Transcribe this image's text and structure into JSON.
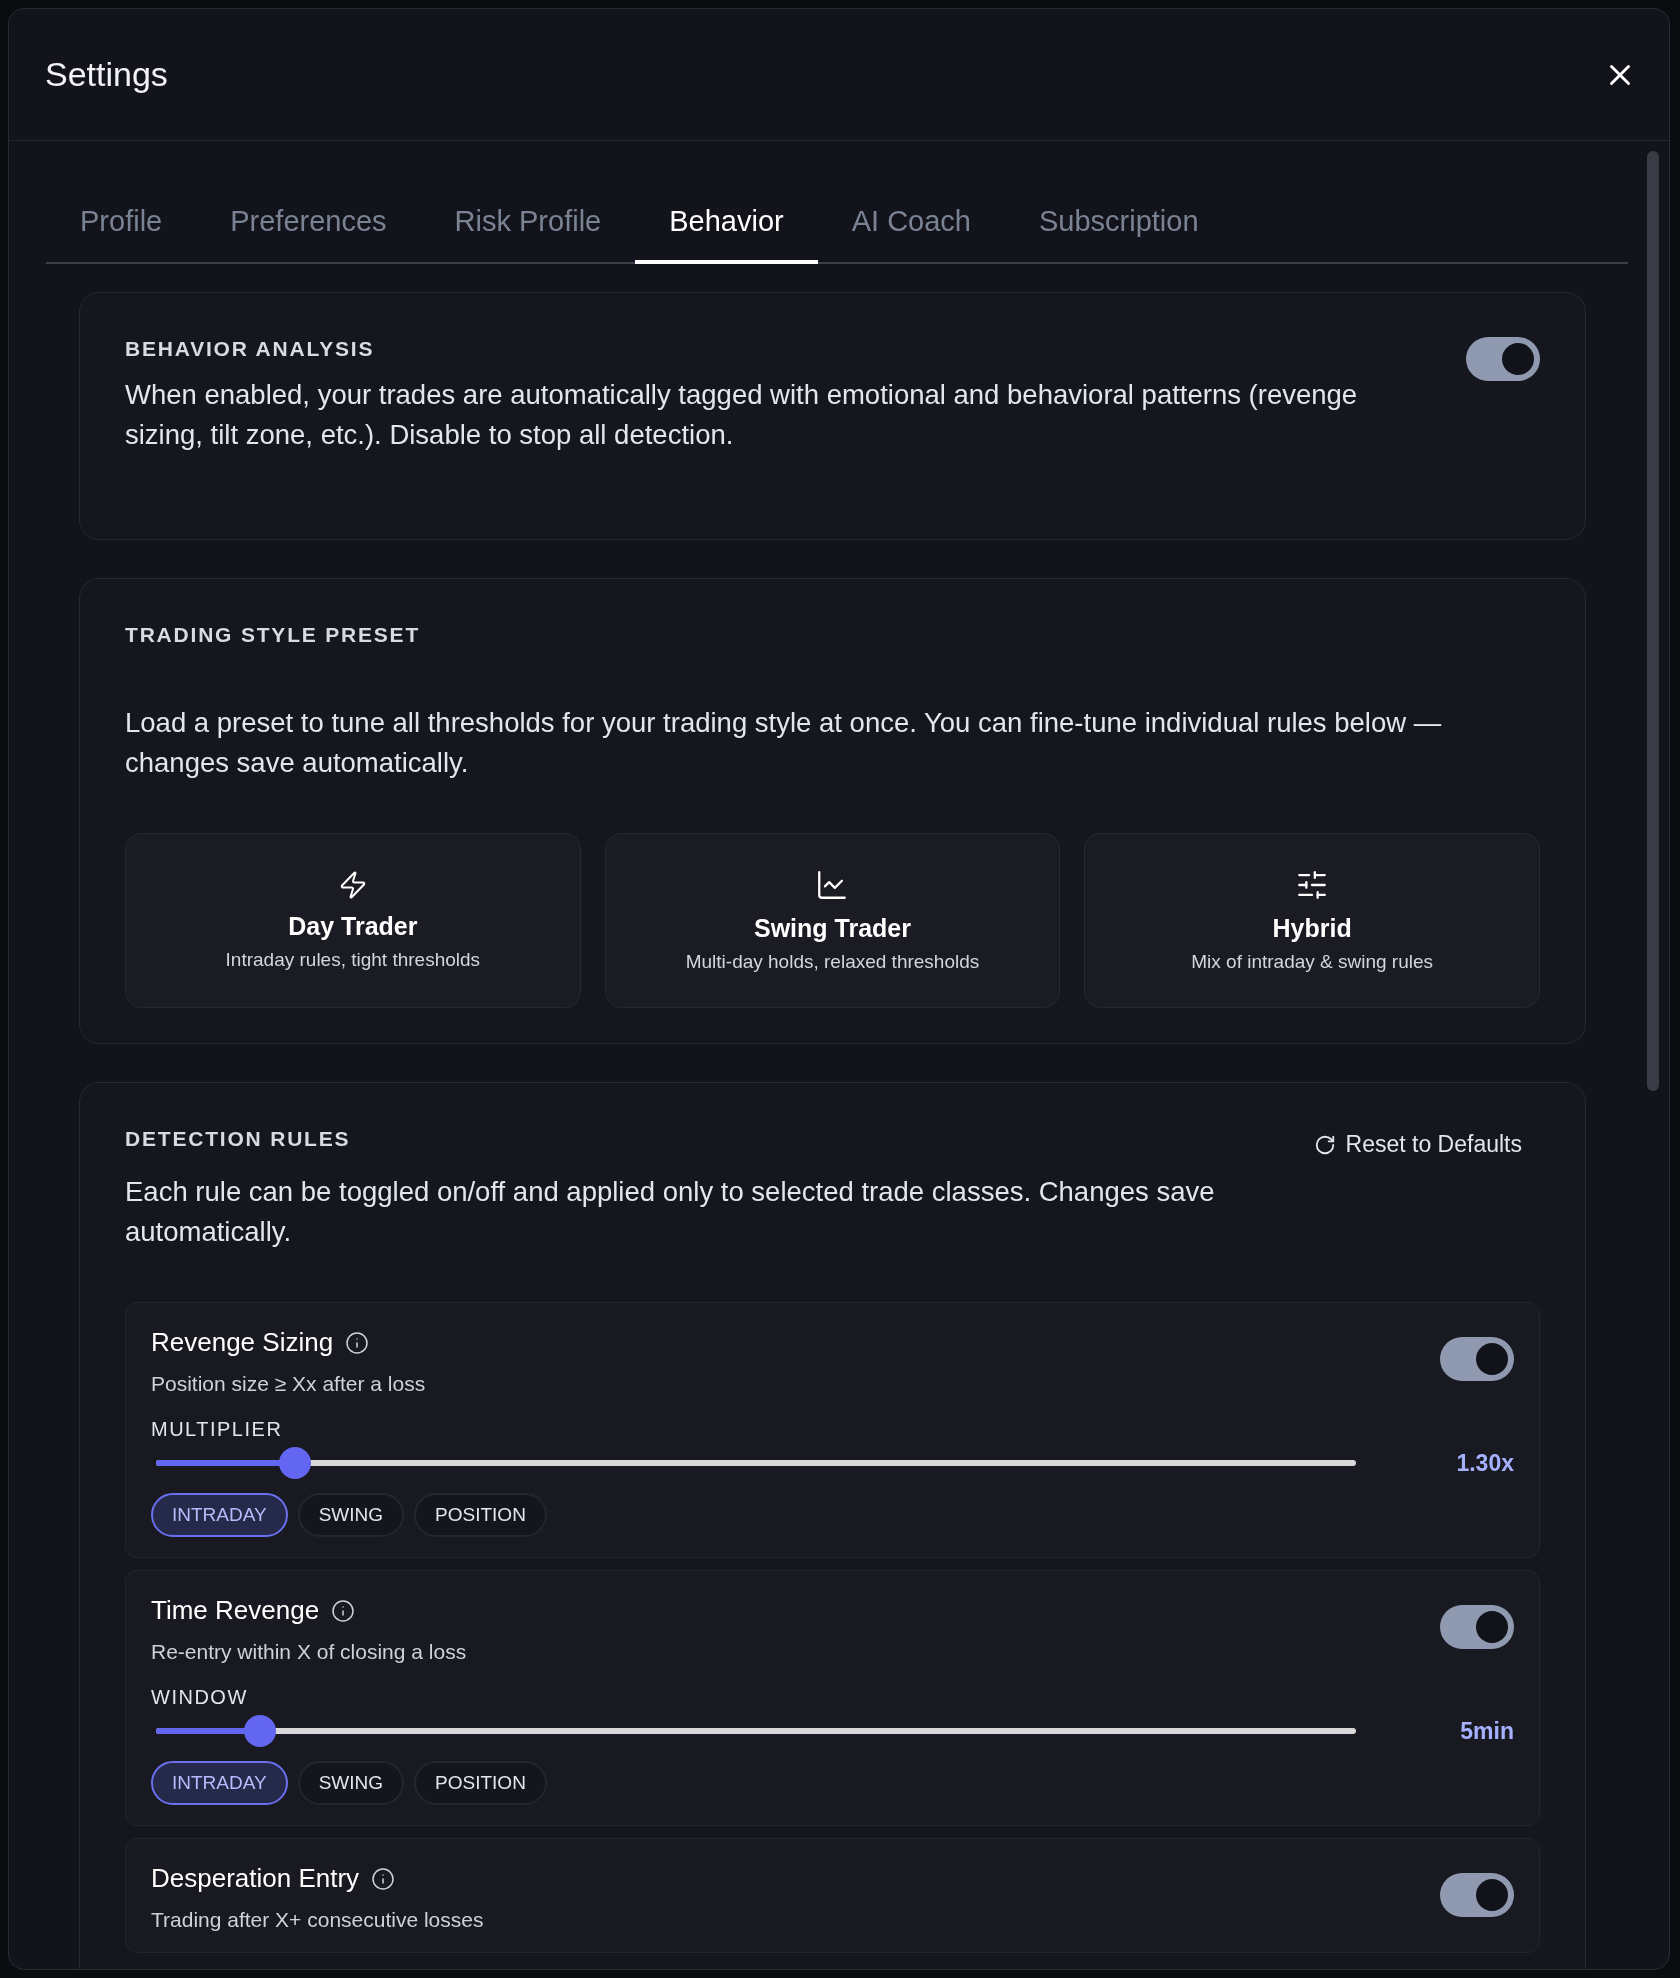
{
  "window": {
    "title": "Settings"
  },
  "tabs": [
    {
      "label": "Profile",
      "selected": false
    },
    {
      "label": "Preferences",
      "selected": false
    },
    {
      "label": "Risk Profile",
      "selected": false
    },
    {
      "label": "Behavior",
      "selected": true
    },
    {
      "label": "AI Coach",
      "selected": false
    },
    {
      "label": "Subscription",
      "selected": false
    }
  ],
  "behavior_analysis": {
    "heading": "BEHAVIOR ANALYSIS",
    "description": "When enabled, your trades are automatically tagged with emotional and behavioral patterns (revenge sizing, tilt zone, etc.). Disable to stop all detection.",
    "on": true
  },
  "trading_style_preset": {
    "heading": "TRADING STYLE PRESET",
    "description": "Load a preset to tune all thresholds for your trading style at once. You can fine-tune individual rules below — changes save automatically.",
    "presets": [
      {
        "kind": "bolt",
        "title": "Day Trader",
        "subtitle": "Intraday rules, tight thresholds"
      },
      {
        "kind": "chart",
        "title": "Swing Trader",
        "subtitle": "Multi-day holds, relaxed thresholds"
      },
      {
        "kind": "sliders",
        "title": "Hybrid",
        "subtitle": "Mix of intraday & swing rules"
      }
    ]
  },
  "detection_rules": {
    "heading": "DETECTION RULES",
    "reset_button": "Reset to Defaults",
    "description": "Each rule can be toggled on/off and applied only to selected trade classes. Changes save automatically.",
    "rules": [
      {
        "title": "Revenge Sizing",
        "subtitle": "Position size ≥ Xx after a loss",
        "on": true,
        "slider_label": "MULTIPLIER",
        "level": 0.116,
        "reading": "1.30x",
        "classes": [
          {
            "label": "INTRADAY",
            "selected": true
          },
          {
            "label": "SWING",
            "selected": false
          },
          {
            "label": "POSITION",
            "selected": false
          }
        ]
      },
      {
        "title": "Time Revenge",
        "subtitle": "Re-entry within X of closing a loss",
        "on": true,
        "slider_label": "WINDOW",
        "level": 0.087,
        "reading": "5min",
        "classes": [
          {
            "label": "INTRADAY",
            "selected": true
          },
          {
            "label": "SWING",
            "selected": false
          },
          {
            "label": "POSITION",
            "selected": false
          }
        ]
      },
      {
        "title": "Desperation Entry",
        "subtitle": "Trading after X+ consecutive losses",
        "on": true
      }
    ]
  }
}
